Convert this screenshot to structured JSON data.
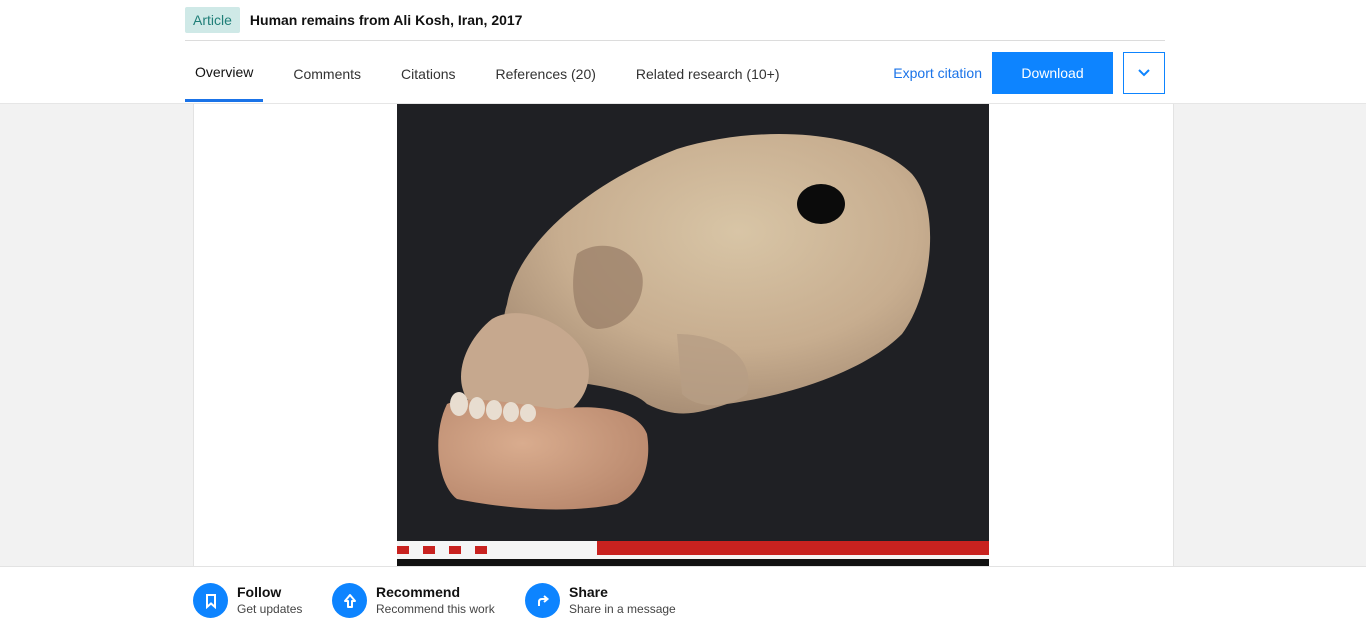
{
  "header": {
    "badge": "Article",
    "title": "Human remains from Ali Kosh, Iran, 2017"
  },
  "tabs": [
    {
      "label": "Overview",
      "active": true
    },
    {
      "label": "Comments",
      "active": false
    },
    {
      "label": "Citations",
      "active": false
    },
    {
      "label": "References (20)",
      "active": false
    },
    {
      "label": "Related research (10+)",
      "active": false
    }
  ],
  "actions": {
    "export_label": "Export citation",
    "download_label": "Download",
    "more_icon": "chevron-down-icon"
  },
  "figure": {
    "description_icon": "skull-photo"
  },
  "bottom_actions": [
    {
      "title": "Follow",
      "subtitle": "Get updates",
      "icon": "bookmark-icon"
    },
    {
      "title": "Recommend",
      "subtitle": "Recommend this work",
      "icon": "arrow-up-icon"
    },
    {
      "title": "Share",
      "subtitle": "Share in a message",
      "icon": "share-arrow-icon"
    }
  ],
  "colors": {
    "accent": "#0d84ff",
    "link": "#1a73e8",
    "badge_bg": "#cfe9e7",
    "badge_text": "#1f7f78"
  }
}
